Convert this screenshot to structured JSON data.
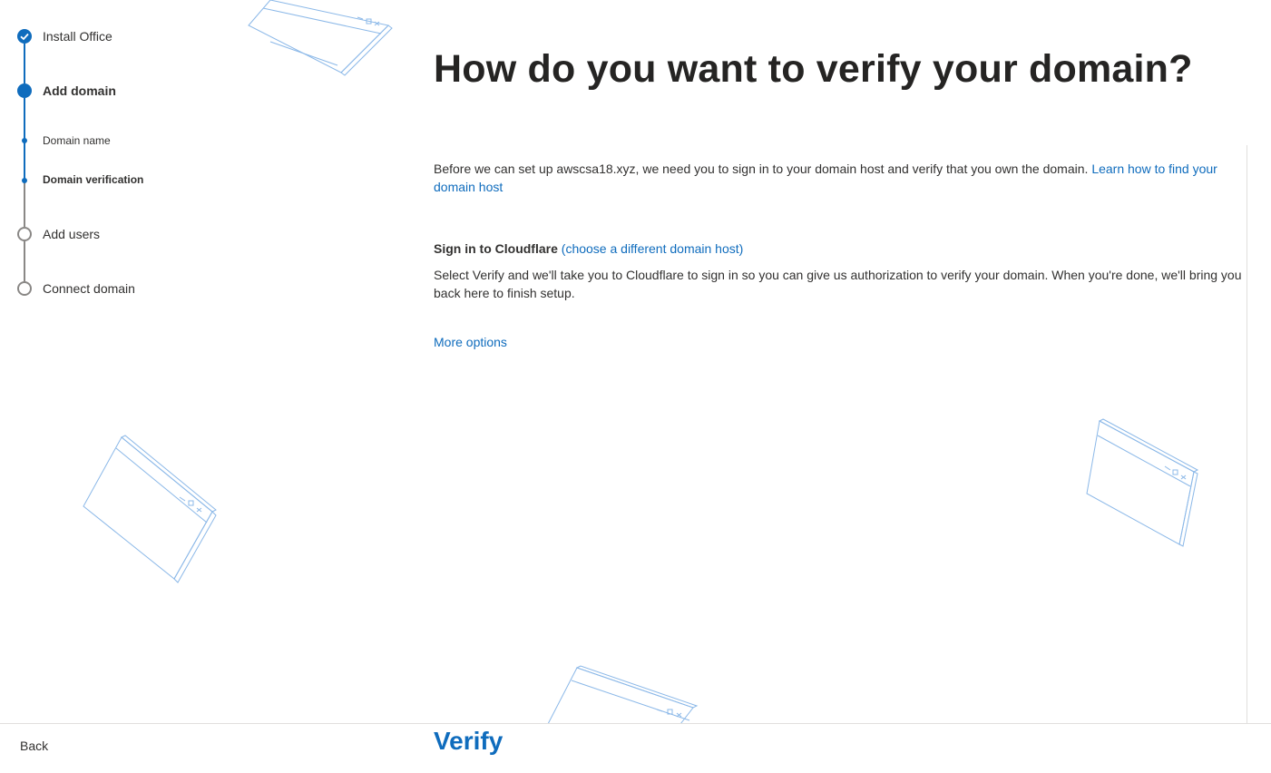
{
  "stepper": {
    "steps": [
      {
        "label": "Install Office",
        "state": "complete"
      },
      {
        "label": "Add domain",
        "state": "current"
      },
      {
        "label": "Domain name",
        "state": "substep-done"
      },
      {
        "label": "Domain verification",
        "state": "substep-current"
      },
      {
        "label": "Add users",
        "state": "pending"
      },
      {
        "label": "Connect domain",
        "state": "pending"
      }
    ]
  },
  "main": {
    "title": "How do you want to verify your domain?",
    "intro_text": "Before we can set up awscsa18.xyz, we need you to sign in to your domain host and verify that you own the domain.",
    "intro_link": "Learn how to find your domain host",
    "signin_heading": "Sign in to Cloudflare",
    "signin_link": "(choose a different domain host)",
    "signin_body": "Select Verify and we'll take you to Cloudflare to sign in so you can give us authorization to verify your domain. When you're done, we'll bring you back here to finish setup.",
    "more_options": "More options"
  },
  "footer": {
    "back_label": "Back",
    "verify_label": "Verify"
  },
  "colors": {
    "accent": "#0f6cbd",
    "pending": "#8a8886",
    "text": "#323130"
  }
}
